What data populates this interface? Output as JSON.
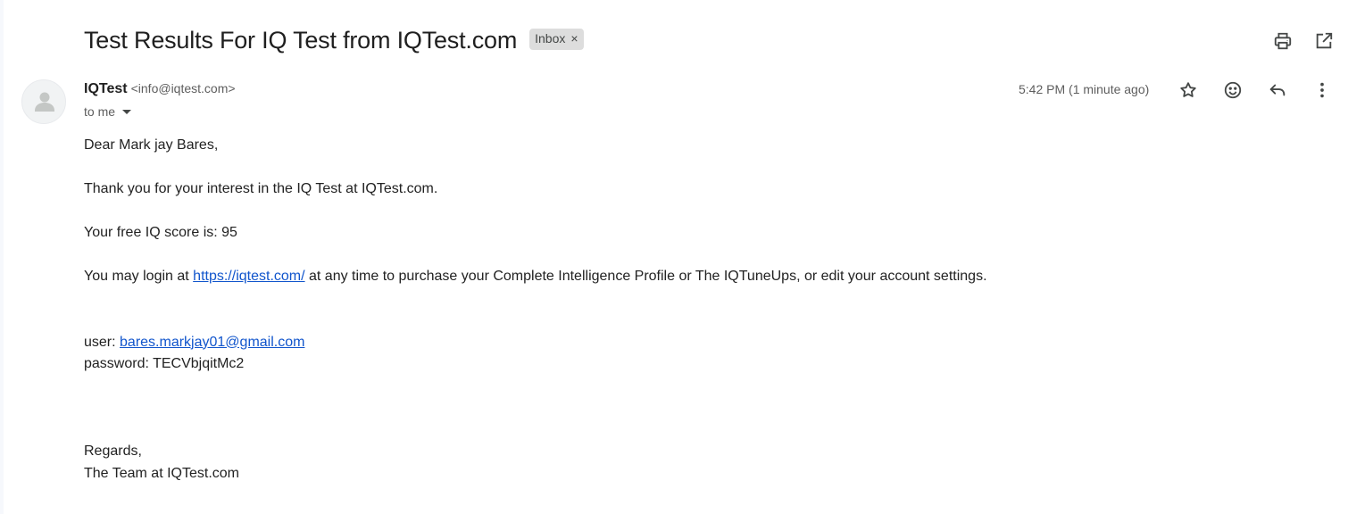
{
  "subject": "Test Results For IQ Test from IQTest.com",
  "label": {
    "text": "Inbox",
    "remove": "×"
  },
  "top_actions": {
    "icons": [
      "print-icon",
      "open-in-new-window-icon"
    ]
  },
  "sender": {
    "name": "IQTest",
    "email": "<info@iqtest.com>",
    "to": "to me",
    "time": "5:42 PM (1 minute ago)",
    "avatar_icon": "person-avatar-icon"
  },
  "message_actions": {
    "icons": [
      "star-icon",
      "emoji-reaction-icon",
      "reply-icon",
      "more-vert-icon"
    ]
  },
  "body": {
    "greeting": "Dear Mark jay Bares,",
    "thanks": "Thank you for your interest in the IQ Test at IQTest.com.",
    "score": "Your free IQ score is: 95",
    "login_prefix": "You may login at",
    "login_link": "https://iqtest.com/",
    "login_suffix": "at any time to purchase your Complete Intelligence Profile or The IQTuneUps, or edit your account settings.",
    "user_label": "user:",
    "user_value": "bares.markjay01@gmail.com",
    "password": "password: TECVbjqitMc2",
    "regards": "Regards,",
    "signature": "The Team at IQTest.com"
  },
  "colors": {
    "link": "#1155cc",
    "chip_bg": "#dddddd",
    "text": "#222222",
    "meta": "#5e5e5e"
  }
}
